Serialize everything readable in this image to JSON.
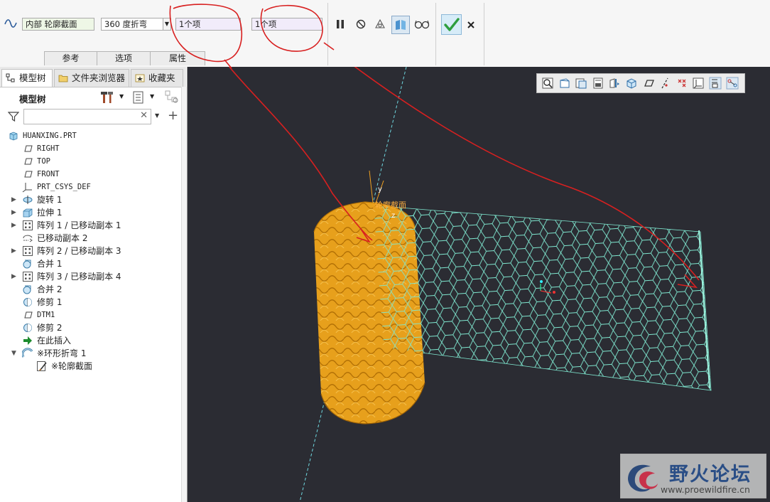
{
  "dashboard": {
    "type_value": "内部 轮廓截面",
    "bend_value": "360 度折弯",
    "collector_1": "1个项",
    "collector_2": "1个项",
    "tabs": [
      "参考",
      "选项",
      "属性"
    ],
    "icons": {
      "feature": "sine-wave-icon",
      "pause": "pause-icon",
      "no_preview": "no-preview-icon",
      "preview_geometry": "preview-geometry-icon",
      "preview_feature": "preview-feature-icon",
      "verify": "glasses-icon",
      "ok": "checkmark-icon",
      "cancel": "close-icon"
    },
    "colors": {
      "ok": "#2e9e3e",
      "active_field": "#eef7e6",
      "collector": "#f1ecfa"
    }
  },
  "left_panel": {
    "tabs": [
      {
        "label": "模型树",
        "icon": "model-tree-icon"
      },
      {
        "label": "文件夹浏览器",
        "icon": "folder-browser-icon"
      },
      {
        "label": "收藏夹",
        "icon": "favorites-icon"
      }
    ],
    "header": "模型树",
    "search_placeholder": "",
    "tree": [
      {
        "label": "HUANXING.PRT",
        "level": 0,
        "icon": "part-icon",
        "expander": "",
        "mono": true
      },
      {
        "label": "RIGHT",
        "level": 1,
        "icon": "datum-plane-icon",
        "expander": "",
        "mono": true
      },
      {
        "label": "TOP",
        "level": 1,
        "icon": "datum-plane-icon",
        "expander": "",
        "mono": true
      },
      {
        "label": "FRONT",
        "level": 1,
        "icon": "datum-plane-icon",
        "expander": "",
        "mono": true
      },
      {
        "label": "PRT_CSYS_DEF",
        "level": 1,
        "icon": "coordinate-system-icon",
        "expander": "",
        "mono": true
      },
      {
        "label": "旋转 1",
        "level": 1,
        "icon": "revolve-icon",
        "expander": "▶",
        "mono": false
      },
      {
        "label": "拉伸 1",
        "level": 1,
        "icon": "extrude-icon",
        "expander": "▶",
        "mono": false
      },
      {
        "label": "阵列 1 / 已移动副本 1",
        "level": 1,
        "icon": "pattern-icon",
        "expander": "▶",
        "mono": false
      },
      {
        "label": "已移动副本 2",
        "level": 1,
        "icon": "move-copy-icon",
        "expander": "",
        "mono": false
      },
      {
        "label": "阵列 2 / 已移动副本 3",
        "level": 1,
        "icon": "pattern-icon",
        "expander": "▶",
        "mono": false
      },
      {
        "label": "合并 1",
        "level": 1,
        "icon": "merge-icon",
        "expander": "",
        "mono": false
      },
      {
        "label": "阵列 3 / 已移动副本 4",
        "level": 1,
        "icon": "pattern-icon",
        "expander": "▶",
        "mono": false
      },
      {
        "label": "合并 2",
        "level": 1,
        "icon": "merge-icon",
        "expander": "",
        "mono": false
      },
      {
        "label": "修剪 1",
        "level": 1,
        "icon": "trim-icon",
        "expander": "",
        "mono": false
      },
      {
        "label": "DTM1",
        "level": 1,
        "icon": "datum-plane-icon",
        "expander": "",
        "mono": true
      },
      {
        "label": "修剪 2",
        "level": 1,
        "icon": "trim-icon",
        "expander": "",
        "mono": false
      },
      {
        "label": "在此插入",
        "level": 1,
        "icon": "insert-here-arrow-icon",
        "expander": "",
        "mono": false
      },
      {
        "label": "※环形折弯 1",
        "level": 1,
        "icon": "toroidal-bend-icon",
        "expander": "▼",
        "mono": false
      },
      {
        "label": "※轮廓截面",
        "level": 2,
        "icon": "sketch-icon",
        "expander": "",
        "mono": false
      }
    ]
  },
  "viewport": {
    "labels": {
      "section": "轮廓截面",
      "axis_y": "y",
      "axis_z": "z"
    },
    "colors": {
      "background": "#2b2c33",
      "solid": "#e8a21d",
      "mesh": "#7fe8d0",
      "annotation": "#d82020"
    },
    "graphics_toolbar": [
      "refit-icon",
      "zoom-in-icon",
      "zoom-out-icon",
      "saved-views-icon",
      "display-style-icon",
      "view-manager-icon",
      "plane-display-icon",
      "axis-display-icon",
      "point-display-icon",
      "csys-display-icon",
      "spin-center-icon",
      "annotation-display-icon"
    ]
  },
  "watermark": {
    "title": "野火论坛",
    "url": "www.proewildfire.cn"
  }
}
